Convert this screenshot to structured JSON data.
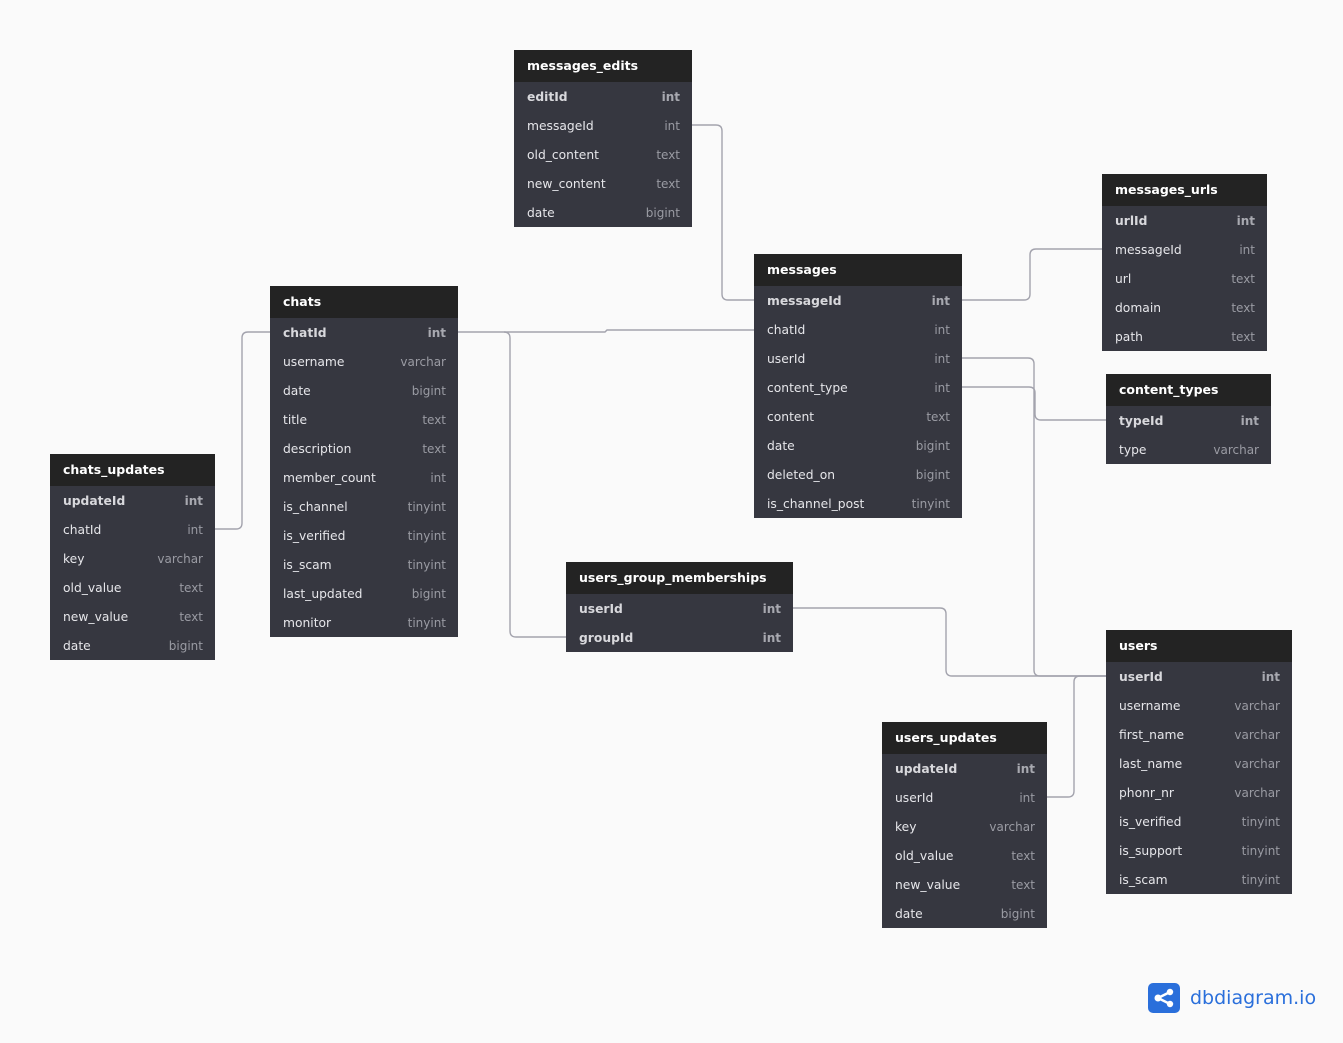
{
  "brand": {
    "name": "dbdiagram.io",
    "icon": "share-nodes-icon",
    "color": "#2a6fdb"
  },
  "colors": {
    "background": "#fafafa",
    "table_header": "#232323",
    "table_body": "#363740",
    "edge": "#a3a3ad"
  },
  "tables": {
    "messages_edits": {
      "name": "messages_edits",
      "fields": [
        {
          "name": "editId",
          "type": "int",
          "pk": true
        },
        {
          "name": "messageId",
          "type": "int"
        },
        {
          "name": "old_content",
          "type": "text"
        },
        {
          "name": "new_content",
          "type": "text"
        },
        {
          "name": "date",
          "type": "bigint"
        }
      ]
    },
    "messages_urls": {
      "name": "messages_urls",
      "fields": [
        {
          "name": "urlId",
          "type": "int",
          "pk": true
        },
        {
          "name": "messageId",
          "type": "int"
        },
        {
          "name": "url",
          "type": "text"
        },
        {
          "name": "domain",
          "type": "text"
        },
        {
          "name": "path",
          "type": "text"
        }
      ]
    },
    "messages": {
      "name": "messages",
      "fields": [
        {
          "name": "messageId",
          "type": "int",
          "pk": true
        },
        {
          "name": "chatId",
          "type": "int"
        },
        {
          "name": "userId",
          "type": "int"
        },
        {
          "name": "content_type",
          "type": "int"
        },
        {
          "name": "content",
          "type": "text"
        },
        {
          "name": "date",
          "type": "bigint"
        },
        {
          "name": "deleted_on",
          "type": "bigint"
        },
        {
          "name": "is_channel_post",
          "type": "tinyint"
        }
      ]
    },
    "content_types": {
      "name": "content_types",
      "fields": [
        {
          "name": "typeId",
          "type": "int",
          "pk": true
        },
        {
          "name": "type",
          "type": "varchar"
        }
      ]
    },
    "chats": {
      "name": "chats",
      "fields": [
        {
          "name": "chatId",
          "type": "int",
          "pk": true
        },
        {
          "name": "username",
          "type": "varchar"
        },
        {
          "name": "date",
          "type": "bigint"
        },
        {
          "name": "title",
          "type": "text"
        },
        {
          "name": "description",
          "type": "text"
        },
        {
          "name": "member_count",
          "type": "int"
        },
        {
          "name": "is_channel",
          "type": "tinyint"
        },
        {
          "name": "is_verified",
          "type": "tinyint"
        },
        {
          "name": "is_scam",
          "type": "tinyint"
        },
        {
          "name": "last_updated",
          "type": "bigint"
        },
        {
          "name": "monitor",
          "type": "tinyint"
        }
      ]
    },
    "chats_updates": {
      "name": "chats_updates",
      "fields": [
        {
          "name": "updateId",
          "type": "int",
          "pk": true
        },
        {
          "name": "chatId",
          "type": "int"
        },
        {
          "name": "key",
          "type": "varchar"
        },
        {
          "name": "old_value",
          "type": "text"
        },
        {
          "name": "new_value",
          "type": "text"
        },
        {
          "name": "date",
          "type": "bigint"
        }
      ]
    },
    "users_group_memberships": {
      "name": "users_group_memberships",
      "fields": [
        {
          "name": "userId",
          "type": "int",
          "pk": true
        },
        {
          "name": "groupId",
          "type": "int",
          "pk": true
        }
      ]
    },
    "users": {
      "name": "users",
      "fields": [
        {
          "name": "userId",
          "type": "int",
          "pk": true
        },
        {
          "name": "username",
          "type": "varchar"
        },
        {
          "name": "first_name",
          "type": "varchar"
        },
        {
          "name": "last_name",
          "type": "varchar"
        },
        {
          "name": "phonr_nr",
          "type": "varchar"
        },
        {
          "name": "is_verified",
          "type": "tinyint"
        },
        {
          "name": "is_support",
          "type": "tinyint"
        },
        {
          "name": "is_scam",
          "type": "tinyint"
        }
      ]
    },
    "users_updates": {
      "name": "users_updates",
      "fields": [
        {
          "name": "updateId",
          "type": "int",
          "pk": true
        },
        {
          "name": "userId",
          "type": "int"
        },
        {
          "name": "key",
          "type": "varchar"
        },
        {
          "name": "old_value",
          "type": "text"
        },
        {
          "name": "new_value",
          "type": "text"
        },
        {
          "name": "date",
          "type": "bigint"
        }
      ]
    }
  },
  "relationships": [
    {
      "from": "messages_edits.messageId",
      "to": "messages.messageId"
    },
    {
      "from": "messages.messageId",
      "to": "messages_urls.messageId"
    },
    {
      "from": "messages.chatId",
      "to": "chats.chatId"
    },
    {
      "from": "chats_updates.chatId",
      "to": "chats.chatId"
    },
    {
      "from": "users_group_memberships.groupId",
      "to": "chats.chatId"
    },
    {
      "from": "messages.userId",
      "to": "users.userId"
    },
    {
      "from": "messages.content_type",
      "to": "content_types.typeId"
    },
    {
      "from": "users_group_memberships.userId",
      "to": "users.userId"
    },
    {
      "from": "users_updates.userId",
      "to": "users.userId"
    }
  ]
}
